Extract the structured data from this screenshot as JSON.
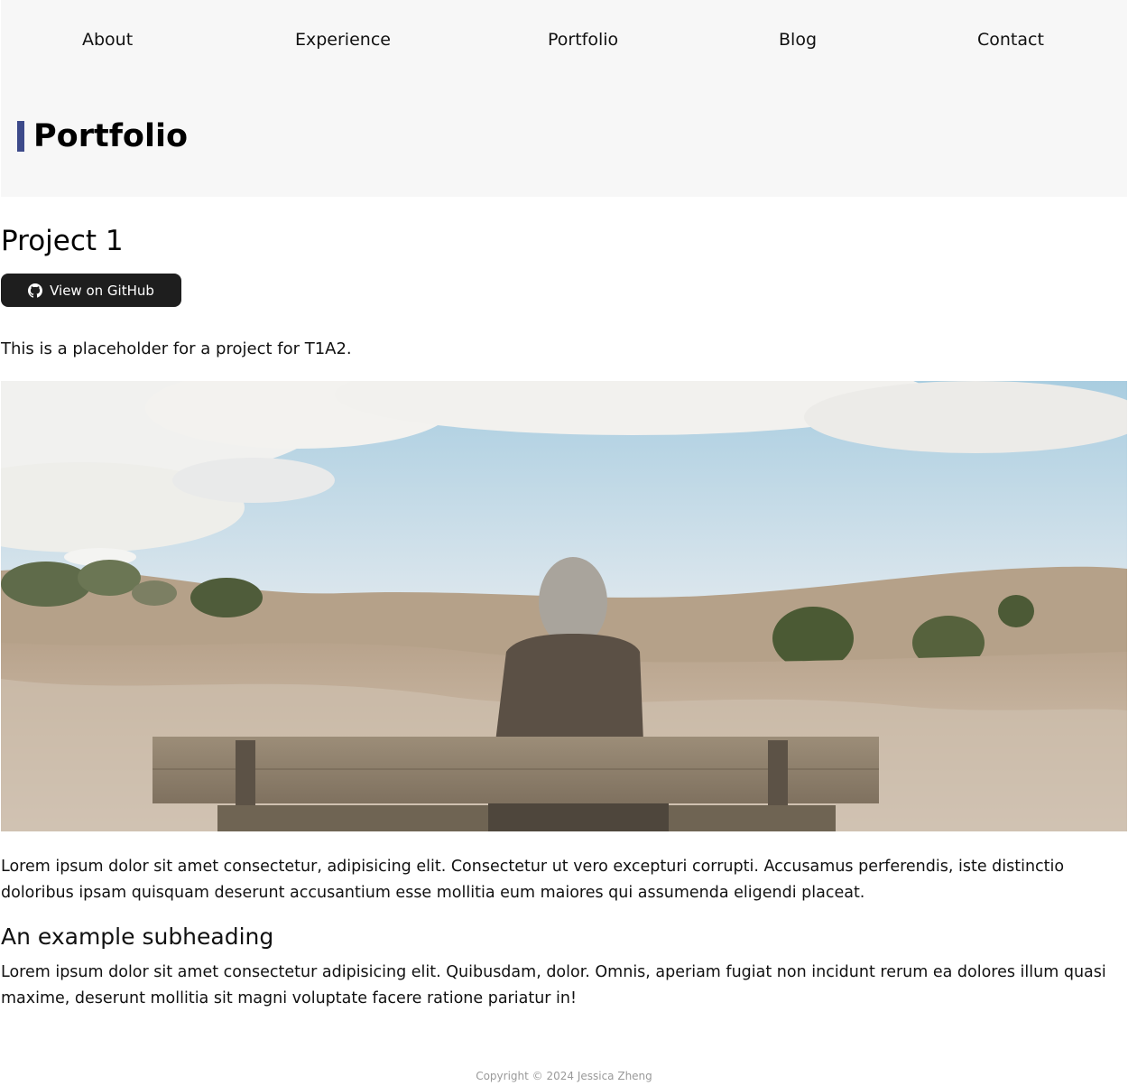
{
  "nav": {
    "items": [
      {
        "label": "About"
      },
      {
        "label": "Experience"
      },
      {
        "label": "Portfolio"
      },
      {
        "label": "Blog"
      },
      {
        "label": "Contact"
      }
    ]
  },
  "header": {
    "title": "Portfolio",
    "accent_color": "#3d4a8a"
  },
  "project": {
    "title": "Project 1",
    "github_button_label": "View on GitHub",
    "github_icon": "github-icon",
    "intro": "This is a placeholder for a project for T1A2.",
    "image_description_icon": "photo",
    "paragraph_1": "Lorem ipsum dolor sit amet consectetur, adipisicing elit. Consectetur ut vero excepturi corrupti. Accusamus perferendis, iste distinctio doloribus ipsam quisquam deserunt accusantium esse mollitia eum maiores qui assumenda eligendi placeat.",
    "subheading": "An example subheading",
    "paragraph_2": "Lorem ipsum dolor sit amet consectetur adipisicing elit. Quibusdam, dolor. Omnis, aperiam fugiat non incidunt rerum ea dolores illum quasi maxime, deserunt mollitia sit magni voluptate facere ratione pariatur in!"
  },
  "footer": {
    "copyright": "Copyright © 2024 Jessica Zheng"
  }
}
